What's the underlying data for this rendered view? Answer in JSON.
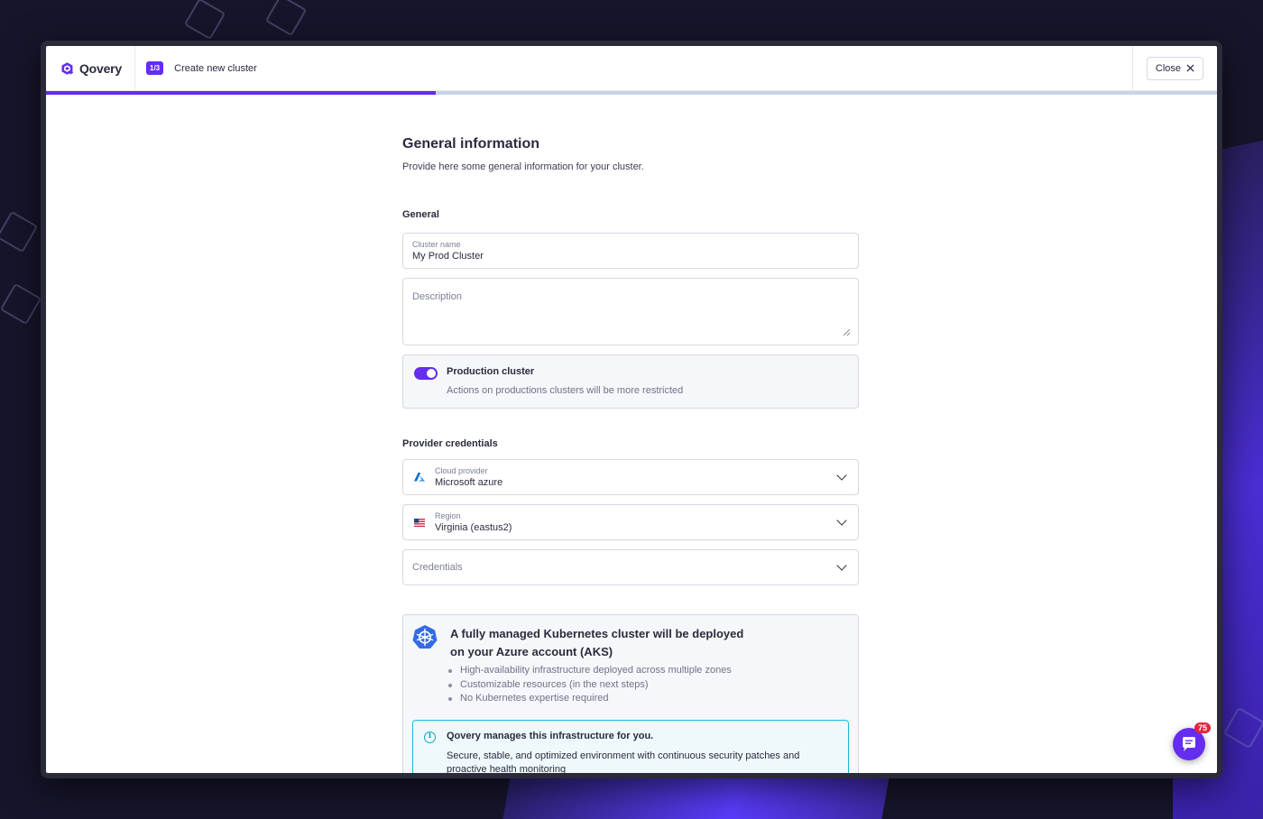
{
  "header": {
    "brand_name": "Qovery",
    "step_badge": "1/3",
    "step_title": "Create new cluster",
    "close_label": "Close"
  },
  "progress": {
    "value_fraction": 0.333
  },
  "page": {
    "title": "General information",
    "subtitle": "Provide here some general information for your cluster."
  },
  "general": {
    "section_title": "General",
    "cluster_name_label": "Cluster name",
    "cluster_name_value": "My Prod Cluster",
    "description_placeholder": "Description",
    "production_toggle": {
      "on": true,
      "title": "Production cluster",
      "description": "Actions on productions clusters will be more restricted"
    }
  },
  "provider": {
    "section_title": "Provider credentials",
    "cloud_provider_label": "Cloud provider",
    "cloud_provider_value": "Microsoft azure",
    "region_label": "Region",
    "region_value": "Virginia (eastus2)",
    "credentials_placeholder": "Credentials"
  },
  "info": {
    "title_line1": "A fully managed Kubernetes cluster will be deployed",
    "title_line2": "on your Azure account (AKS)",
    "bullets": [
      "High-availability infrastructure deployed across multiple zones",
      "Customizable resources (in the next steps)",
      "No Kubernetes expertise required"
    ],
    "notice_title": "Qovery manages this infrastructure for you.",
    "notice_text": "Secure, stable, and optimized environment with continuous security patches and proactive health monitoring"
  },
  "chat": {
    "badge_count": "75"
  },
  "colors": {
    "accent": "#642df0",
    "info_border": "#19b8d6",
    "badge": "#e5243f"
  }
}
